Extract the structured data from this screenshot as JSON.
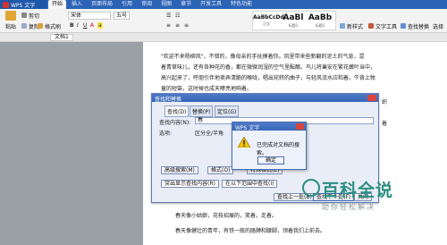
{
  "app": {
    "title": "WPS 文字"
  },
  "tabs": [
    "开始",
    "插入",
    "页面布局",
    "引用",
    "审阅",
    "视图",
    "章节",
    "开发工具",
    "特色功能"
  ],
  "ribbon": {
    "paste": "粘贴",
    "cut": "剪切",
    "copy": "复制",
    "format_painter": "格式刷",
    "font_name": "宋体",
    "font_size": "五号",
    "styles": [
      {
        "sample": "AaBbCcDd",
        "name": "正文"
      },
      {
        "sample": "AaBl",
        "name": "标题1"
      },
      {
        "sample": "AaBb",
        "name": "标题2"
      }
    ],
    "new_style": "新样式",
    "text_tools": "文字工具",
    "find_replace": "查找替换",
    "select": "选择"
  },
  "doc_tab": "文档1",
  "document": {
    "lines": [
      "\"欢迎不来杨柳风\"，不错的，像母亲的手抚摸着你。风里带来些新翻的泥土的气息，混",
      "着青草味儿，还有各种花的香，都在微微润湿的空气里酝酿。鸟儿将巢安在繁花嫩叶当中，",
      "高兴起来了，呼朋引伴地卖弄清脆的喉咙，唱出宛转的曲子，与轻风流水应和着。牛背上牧",
      "童的短笛，这时候也成天嘹亮地响着。",
      "春天像小姑娘，花枝招展的，笑着，走着。",
      "春天像健壮的青年，有铁一般的胳膊和腰脚，领着我们上前去。"
    ],
    "side_letters": [
      "上",
      "上",
      "生"
    ],
    "right_letters": [
      "织",
      "着"
    ]
  },
  "find_dialog": {
    "title": "查找和替换",
    "tabs": [
      "查找(D)",
      "替换(P)",
      "定位(G)"
    ],
    "find_label": "查找内容(N):",
    "find_value": "春",
    "option_label": "选项:",
    "option_value": "区分全/半角",
    "advanced": "高级搜索(M)",
    "format": "格式(O)",
    "special": "特殊格式(E)",
    "highlight": "突出显示查找内容(R)",
    "scope": "在以下范围中查找(I)",
    "find_prev": "查找上一处(B)",
    "find_next": "查找下一处(F)",
    "close": "关闭"
  },
  "alert": {
    "title": "WPS 文字",
    "message": "已完成对文档的搜索。",
    "ok": "确定"
  },
  "watermark": {
    "title": "百科全说",
    "subtitle": "助你轻松解决"
  }
}
